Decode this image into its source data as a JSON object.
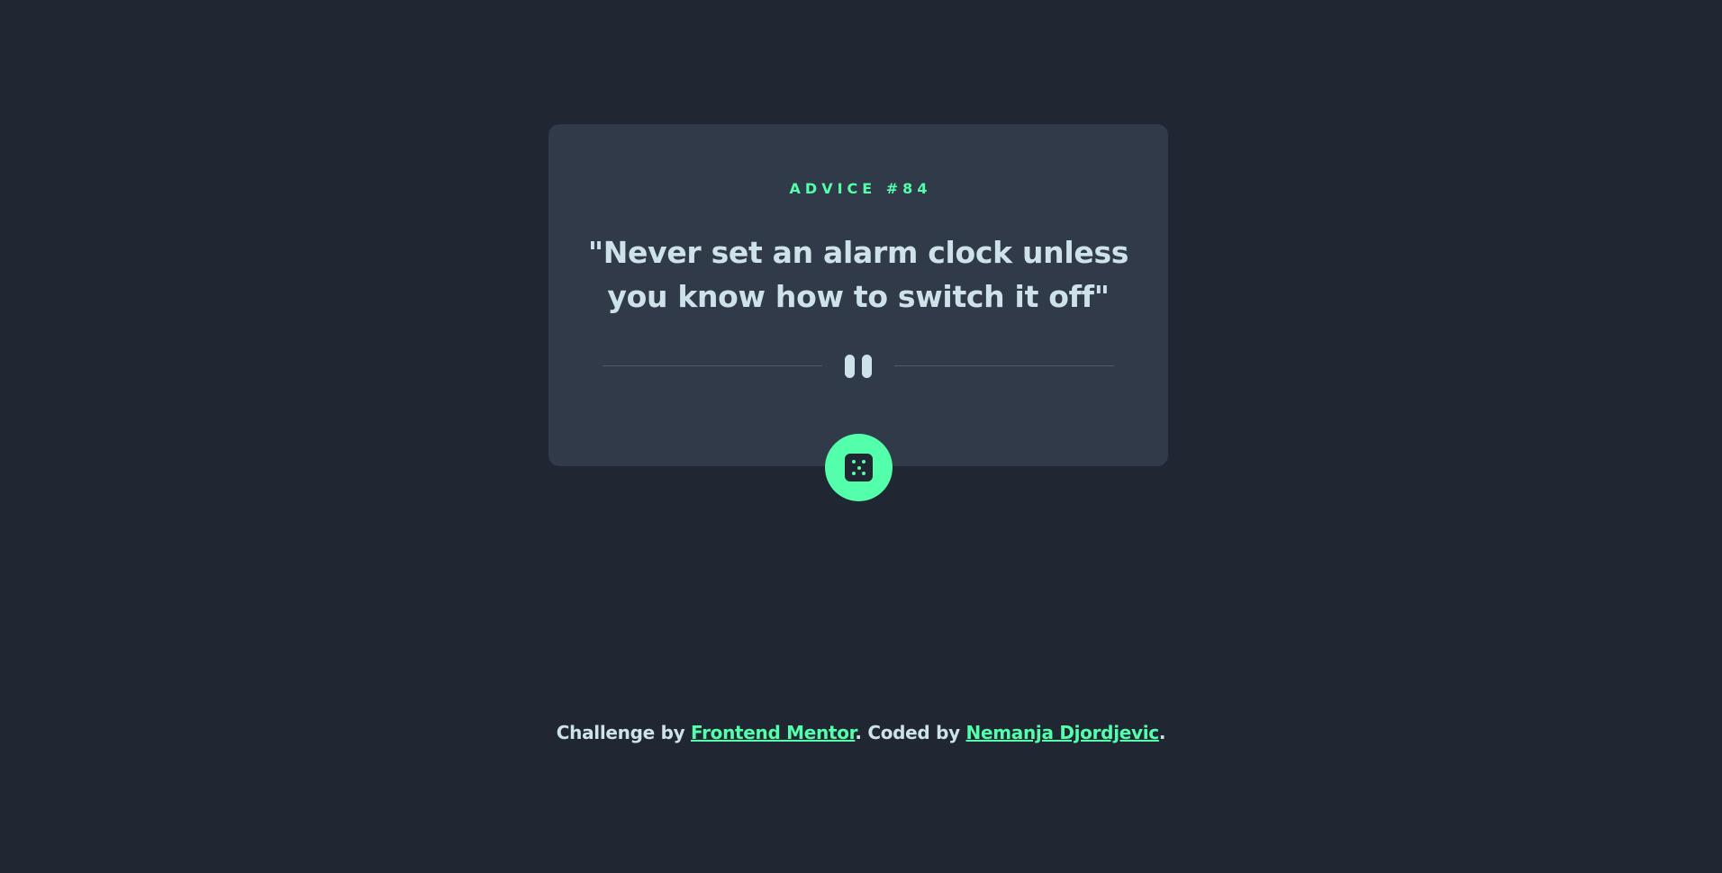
{
  "card": {
    "advice_label": "ADVICE #84",
    "quote": "\"Never set an alarm clock unless you know how to switch it off\""
  },
  "divider": {
    "icon": "pause-icon"
  },
  "dice_button": {
    "icon": "dice-icon"
  },
  "footer": {
    "prefix": "Challenge by ",
    "link1": "Frontend Mentor",
    "middle": ". Coded by ",
    "link2": "Nemanja Djordjevic",
    "suffix": "."
  },
  "colors": {
    "background": "#202632",
    "card": "#313a48",
    "accent": "#53ffaa",
    "text": "#cee3e9",
    "divider": "#4f5b6e"
  }
}
